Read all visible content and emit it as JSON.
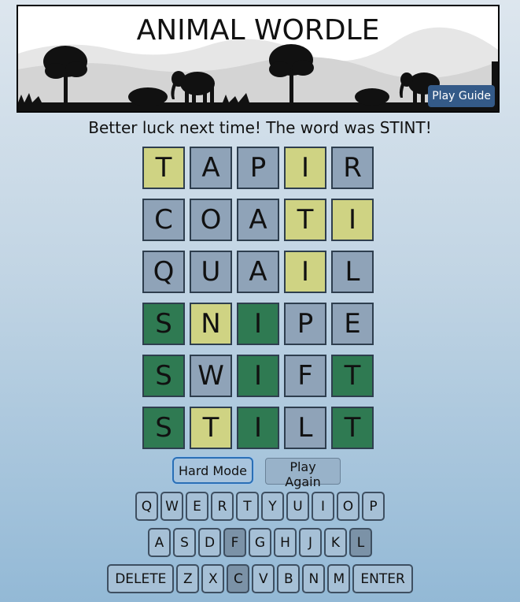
{
  "header": {
    "title": "ANIMAL WORDLE",
    "guide_label": "Play Guide"
  },
  "message": "Better luck next time! The word was STINT!",
  "board": [
    [
      {
        "l": "T",
        "s": "present"
      },
      {
        "l": "A",
        "s": "absent"
      },
      {
        "l": "P",
        "s": "absent"
      },
      {
        "l": "I",
        "s": "present"
      },
      {
        "l": "R",
        "s": "absent"
      }
    ],
    [
      {
        "l": "C",
        "s": "absent"
      },
      {
        "l": "O",
        "s": "absent"
      },
      {
        "l": "A",
        "s": "absent"
      },
      {
        "l": "T",
        "s": "present"
      },
      {
        "l": "I",
        "s": "present"
      }
    ],
    [
      {
        "l": "Q",
        "s": "absent"
      },
      {
        "l": "U",
        "s": "absent"
      },
      {
        "l": "A",
        "s": "absent"
      },
      {
        "l": "I",
        "s": "present"
      },
      {
        "l": "L",
        "s": "absent"
      }
    ],
    [
      {
        "l": "S",
        "s": "correct"
      },
      {
        "l": "N",
        "s": "present"
      },
      {
        "l": "I",
        "s": "correct"
      },
      {
        "l": "P",
        "s": "absent"
      },
      {
        "l": "E",
        "s": "absent"
      }
    ],
    [
      {
        "l": "S",
        "s": "correct"
      },
      {
        "l": "W",
        "s": "absent"
      },
      {
        "l": "I",
        "s": "correct"
      },
      {
        "l": "F",
        "s": "absent"
      },
      {
        "l": "T",
        "s": "correct"
      }
    ],
    [
      {
        "l": "S",
        "s": "correct"
      },
      {
        "l": "T",
        "s": "present"
      },
      {
        "l": "I",
        "s": "correct"
      },
      {
        "l": "L",
        "s": "absent"
      },
      {
        "l": "T",
        "s": "correct"
      }
    ]
  ],
  "controls": {
    "hard_mode_label": "Hard Mode",
    "play_again_label": "Play Again"
  },
  "keyboard": [
    [
      {
        "k": "Q"
      },
      {
        "k": "W"
      },
      {
        "k": "E"
      },
      {
        "k": "R"
      },
      {
        "k": "T"
      },
      {
        "k": "Y"
      },
      {
        "k": "U"
      },
      {
        "k": "I"
      },
      {
        "k": "O"
      },
      {
        "k": "P"
      }
    ],
    [
      {
        "k": "A"
      },
      {
        "k": "S"
      },
      {
        "k": "D"
      },
      {
        "k": "F",
        "used": true
      },
      {
        "k": "G"
      },
      {
        "k": "H"
      },
      {
        "k": "J"
      },
      {
        "k": "K"
      },
      {
        "k": "L",
        "used": true
      }
    ],
    [
      {
        "k": "DELETE"
      },
      {
        "k": "Z"
      },
      {
        "k": "X"
      },
      {
        "k": "C",
        "used": true
      },
      {
        "k": "V"
      },
      {
        "k": "B"
      },
      {
        "k": "N"
      },
      {
        "k": "M"
      },
      {
        "k": "ENTER"
      }
    ]
  ],
  "colors": {
    "absent": "#8fa3b8",
    "present": "#cfd383",
    "correct": "#2f7a52",
    "button": "#345a88"
  }
}
